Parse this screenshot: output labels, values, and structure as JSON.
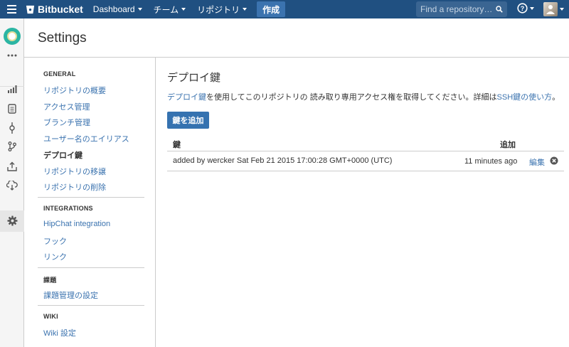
{
  "topbar": {
    "brand": "Bitbucket",
    "nav": [
      "Dashboard",
      "チーム",
      "リポジトリ"
    ],
    "create": "作成",
    "search_placeholder": "Find a repository…",
    "help": "?"
  },
  "page": {
    "title": "Settings"
  },
  "sidebar": {
    "general_heading": "GENERAL",
    "general_items": [
      "リポジトリの概要",
      "アクセス管理",
      "ブランチ管理",
      "ユーザー名のエイリアス",
      "デプロイ鍵",
      "リポジトリの移譲",
      "リポジトリの削除"
    ],
    "integrations_heading": "INTEGRATIONS",
    "integrations_items": [
      "HipChat integration",
      "フック",
      "リンク"
    ],
    "issues_heading": "課題",
    "issues_items": [
      "課題管理の設定"
    ],
    "wiki_heading": "WIKI",
    "wiki_items": [
      "Wiki 設定"
    ]
  },
  "main": {
    "title": "デプロイ鍵",
    "desc_link1": "デプロイ鍵",
    "desc_text": "を使用してこのリポジトリの 読み取り専用アクセス権を取得してください。詳細は",
    "desc_link2": "SSH鍵の使い方",
    "desc_end": "。",
    "add_button": "鍵を追加",
    "table": {
      "col_key": "鍵",
      "col_added": "追加",
      "row": {
        "label": "added by wercker Sat Feb 21 2015 17:00:28 GMT+0000 (UTC)",
        "added": "11 minutes ago",
        "edit": "編集"
      }
    }
  }
}
